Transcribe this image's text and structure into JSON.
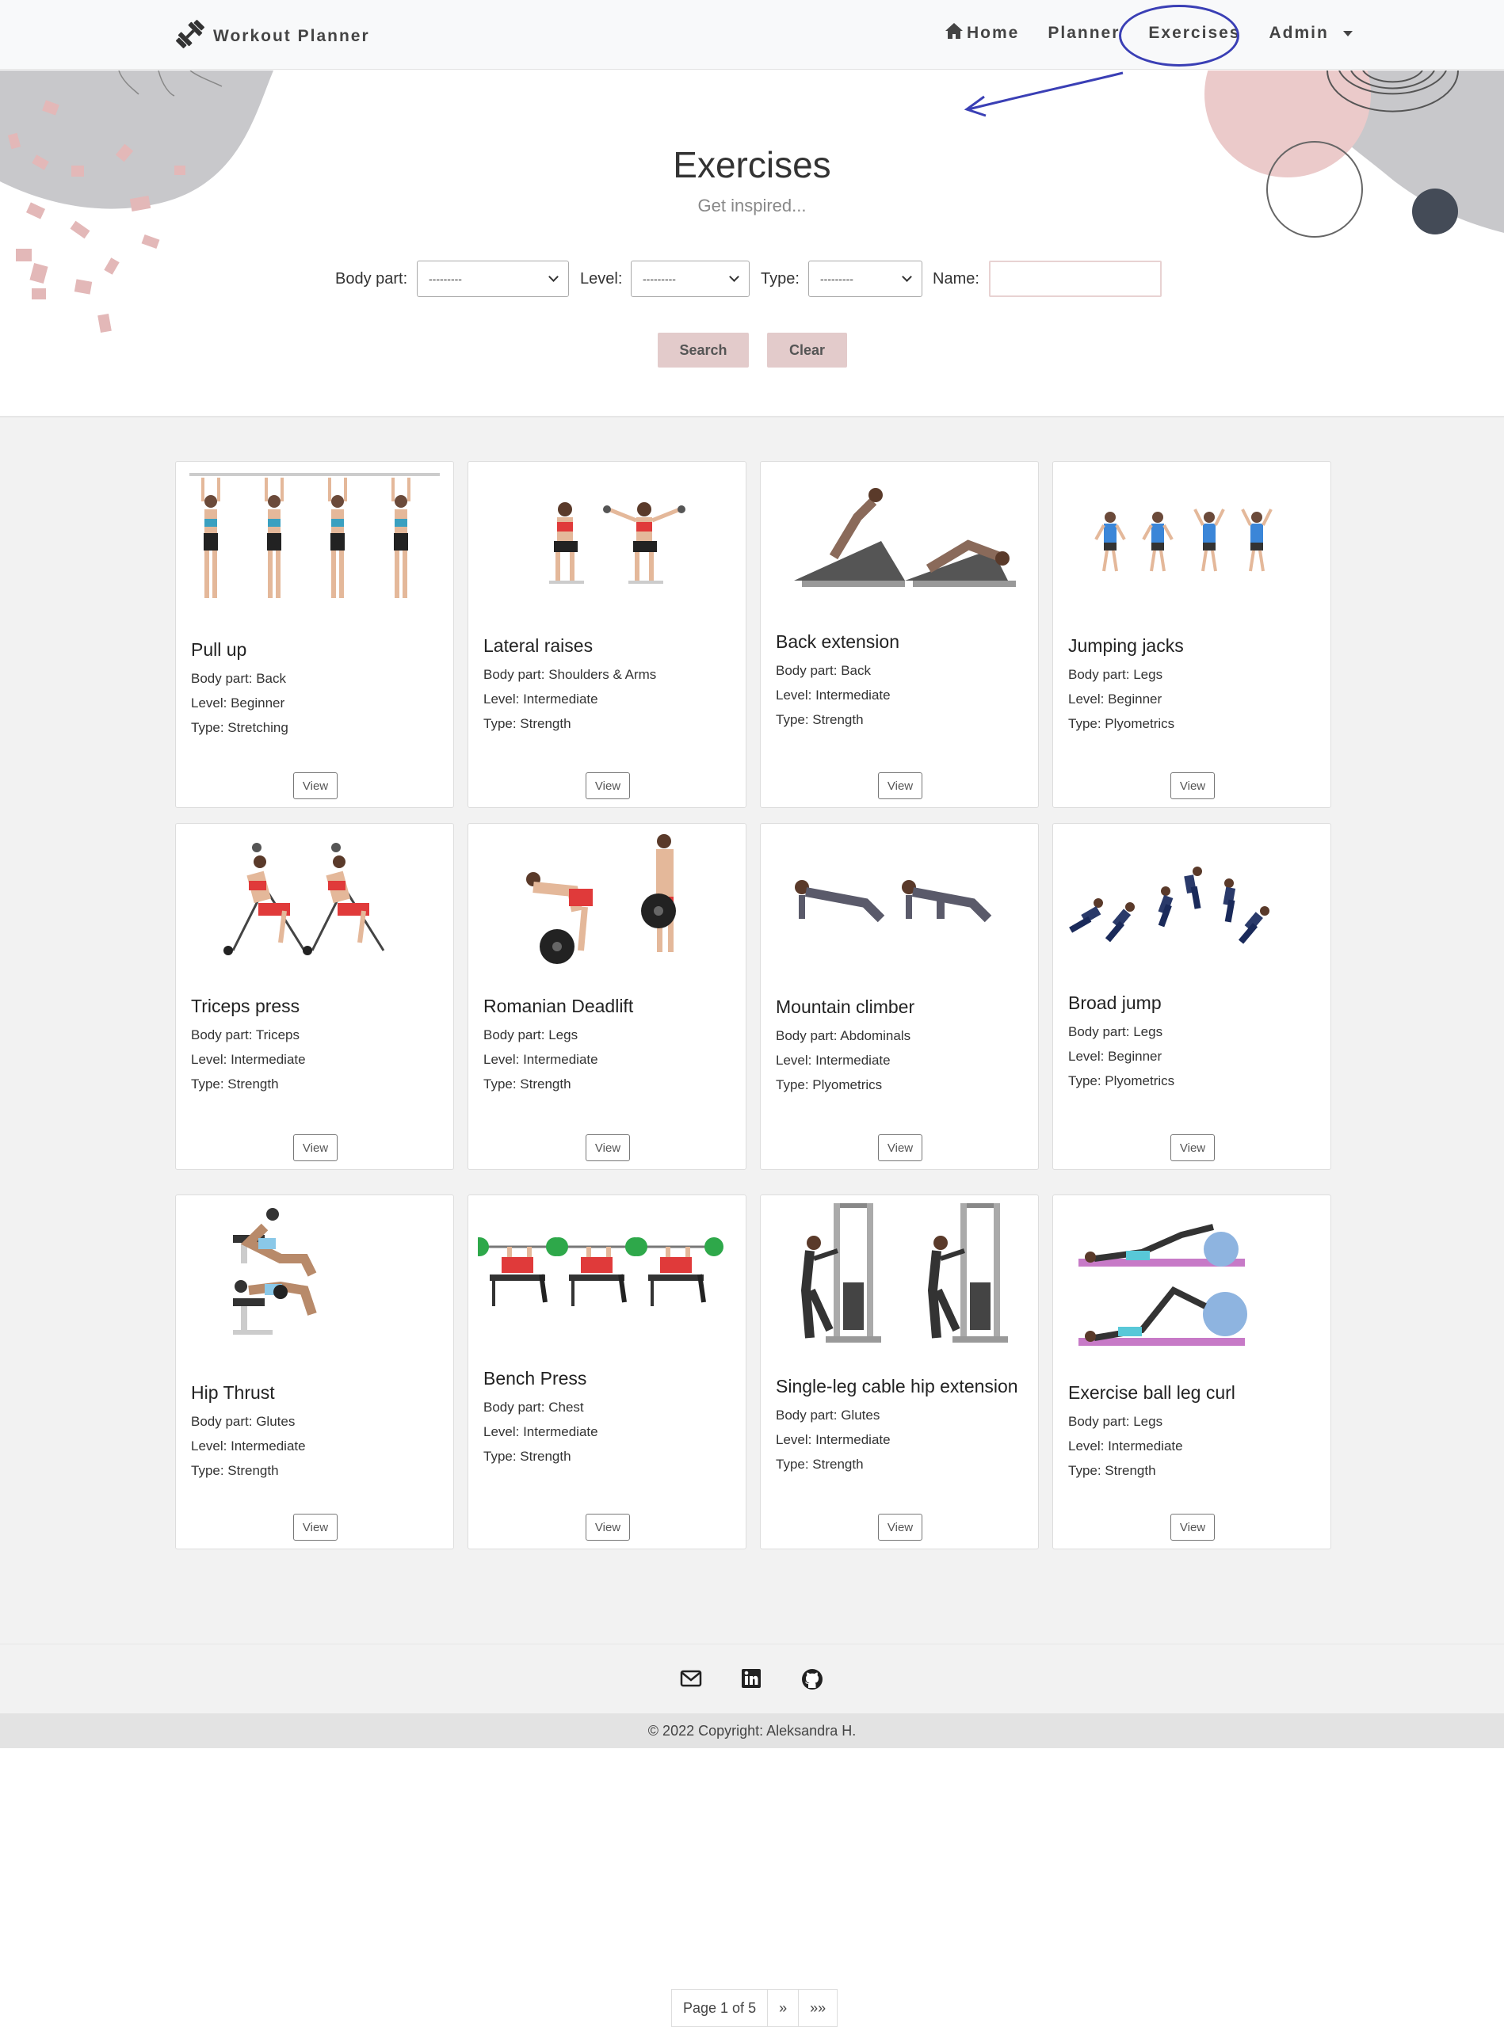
{
  "navbar": {
    "brand": "Workout Planner",
    "links": [
      "Home",
      "Planner",
      "Exercises",
      "Admin"
    ]
  },
  "hero": {
    "title": "Exercises",
    "subtitle": "Get inspired...",
    "filters": {
      "body_part_label": "Body part:",
      "body_part_value": "---------",
      "level_label": "Level:",
      "level_value": "---------",
      "type_label": "Type:",
      "type_value": "---------",
      "name_label": "Name:",
      "name_value": ""
    },
    "search_label": "Search",
    "clear_label": "Clear"
  },
  "exercises": [
    {
      "name": "Pull up",
      "body_part": "Body part: Back",
      "level": "Level: Beginner",
      "type": "Type: Stretching",
      "view": "View"
    },
    {
      "name": "Lateral raises",
      "body_part": "Body part: Shoulders & Arms",
      "level": "Level: Intermediate",
      "type": "Type: Strength",
      "view": "View"
    },
    {
      "name": "Back extension",
      "body_part": "Body part: Back",
      "level": "Level: Intermediate",
      "type": "Type: Strength",
      "view": "View"
    },
    {
      "name": "Jumping jacks",
      "body_part": "Body part: Legs",
      "level": "Level: Beginner",
      "type": "Type: Plyometrics",
      "view": "View"
    },
    {
      "name": "Triceps press",
      "body_part": "Body part: Triceps",
      "level": "Level: Intermediate",
      "type": "Type: Strength",
      "view": "View"
    },
    {
      "name": "Romanian Deadlift",
      "body_part": "Body part: Legs",
      "level": "Level: Intermediate",
      "type": "Type: Strength",
      "view": "View"
    },
    {
      "name": "Mountain climber",
      "body_part": "Body part: Abdominals",
      "level": "Level: Intermediate",
      "type": "Type: Plyometrics",
      "view": "View"
    },
    {
      "name": "Broad jump",
      "body_part": "Body part: Legs",
      "level": "Level: Beginner",
      "type": "Type: Plyometrics",
      "view": "View"
    },
    {
      "name": "Hip Thrust",
      "body_part": "Body part: Glutes",
      "level": "Level: Intermediate",
      "type": "Type: Strength",
      "view": "View"
    },
    {
      "name": "Bench Press",
      "body_part": "Body part: Chest",
      "level": "Level: Intermediate",
      "type": "Type: Strength",
      "view": "View"
    },
    {
      "name": "Single-leg cable hip extension",
      "body_part": "Body part: Glutes",
      "level": "Level: Intermediate",
      "type": "Type: Strength",
      "view": "View"
    },
    {
      "name": "Exercise ball leg curl",
      "body_part": "Body part: Legs",
      "level": "Level: Intermediate",
      "type": "Type: Strength",
      "view": "View"
    }
  ],
  "pagination": {
    "page_text": "Page 1 of 5",
    "next": "»",
    "last": "»»"
  },
  "footer": {
    "icons": [
      "mail-icon",
      "linkedin-icon",
      "github-icon"
    ],
    "copyright": "© 2022 Copyright: Aleksandra H."
  },
  "colors": {
    "accent_button": "#e3cbcb",
    "annotation": "#3a3fb5"
  }
}
